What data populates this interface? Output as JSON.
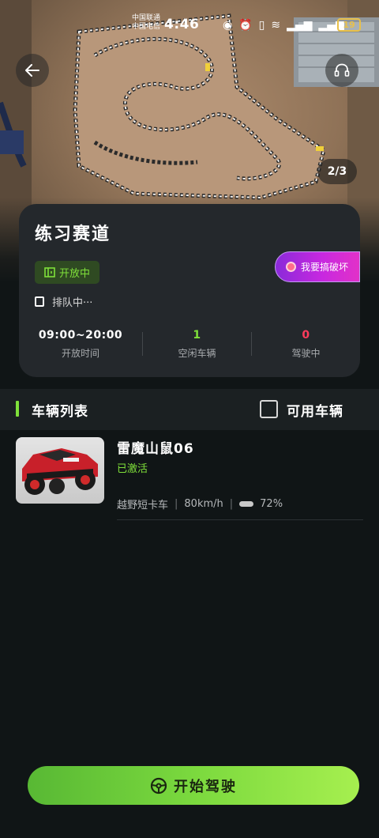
{
  "status_bar": {
    "carrier_1": "中国联通",
    "carrier_2": "中国电信",
    "time": "4:46",
    "battery": "19"
  },
  "hero": {
    "pager": "2/3"
  },
  "track_card": {
    "title": "练习赛道",
    "open_status": "开放中",
    "queue_text": "排队中···",
    "stats": [
      {
        "value": "09:00~20:00",
        "label": "开放时间",
        "color": "#ffffff"
      },
      {
        "value": "1",
        "label": "空闲车辆",
        "color": "#7fe03a"
      },
      {
        "value": "0",
        "label": "驾驶中",
        "color": "#ff3b5c"
      }
    ]
  },
  "break_record_button": "我要搞破坏",
  "vehicle_list": {
    "title": "车辆列表",
    "filter_label": "可用车辆",
    "vehicles": [
      {
        "name": "雷魔山鼠06",
        "status": "已激活",
        "type": "越野短卡车",
        "speed": "80km/h",
        "battery": "72%"
      }
    ]
  },
  "start_button": "开始驾驶",
  "colors": {
    "accent_green": "#7fe03a",
    "danger_red": "#ff3b5c",
    "background": "#101516",
    "card": "#24282c"
  }
}
